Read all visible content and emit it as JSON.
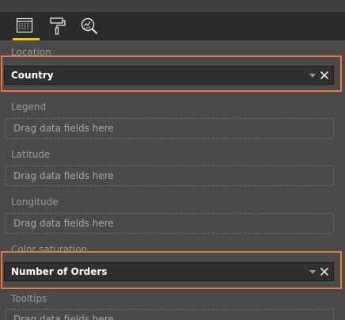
{
  "toolbar": {
    "tabs": [
      {
        "name": "fields",
        "icon": "fields-icon",
        "active": true
      },
      {
        "name": "format",
        "icon": "paint-roller-icon",
        "active": false
      },
      {
        "name": "analytics",
        "icon": "analytics-magnifier-icon",
        "active": false
      }
    ],
    "active_color": "#f2c811"
  },
  "wells": {
    "location": {
      "label": "Location",
      "field": "Country"
    },
    "legend": {
      "label": "Legend",
      "placeholder": "Drag data fields here"
    },
    "latitude": {
      "label": "Latitude",
      "placeholder": "Drag data fields here"
    },
    "longitude": {
      "label": "Longitude",
      "placeholder": "Drag data fields here"
    },
    "color_saturation": {
      "label": "Color saturation",
      "field": "Number of Orders"
    },
    "tooltips": {
      "label": "Tooltips",
      "placeholder": "Drag data fields here"
    }
  },
  "highlight_color": "#f2763a"
}
